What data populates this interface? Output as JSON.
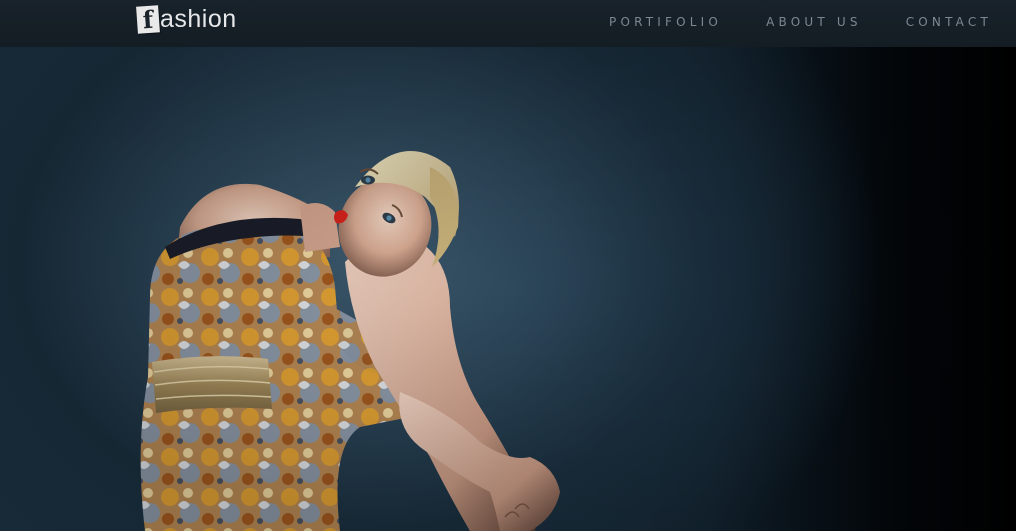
{
  "header": {
    "logo": {
      "mark": "f",
      "text": "ashion"
    },
    "nav": [
      {
        "label": "PORTIFOLIO"
      },
      {
        "label": "ABOUT US"
      },
      {
        "label": "CONTACT"
      }
    ]
  },
  "colors": {
    "navbar_bg": "#18222a",
    "nav_link": "#7c8892",
    "logo_text": "#e6e8ea",
    "hero_bg": "#1d3546"
  },
  "hero": {
    "image_icon": "fashion-model-photo"
  }
}
